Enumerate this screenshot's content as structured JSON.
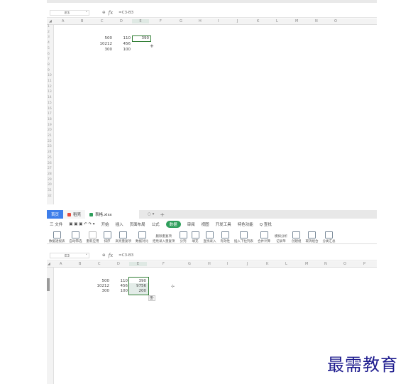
{
  "top": {
    "cell_ref": "E3",
    "formula": "=C3-B3",
    "columns": [
      "A",
      "B",
      "C",
      "D",
      "E",
      "F",
      "G",
      "H",
      "I",
      "J",
      "K",
      "L",
      "M",
      "N",
      "O"
    ],
    "rows": [
      "1",
      "2",
      "3",
      "4",
      "5",
      "6",
      "7",
      "8",
      "9",
      "10",
      "11",
      "12",
      "13",
      "14",
      "15",
      "16",
      "17",
      "18",
      "19",
      "20",
      "21",
      "22",
      "23",
      "24",
      "25",
      "26",
      "27",
      "28",
      "29",
      "30",
      "31",
      "32"
    ],
    "cells": [
      {
        "v": "500"
      },
      {
        "v": "110"
      },
      {
        "v": "390"
      },
      {
        "v": "10212"
      },
      {
        "v": "456"
      },
      {
        "v": "300"
      },
      {
        "v": "100"
      }
    ]
  },
  "bottom": {
    "tabs": {
      "home": "首页",
      "doc": "稻壳",
      "file": "表格.xlsx"
    },
    "menu": [
      "三 文件",
      "开始",
      "插入",
      "页面布局",
      "公式",
      "数据",
      "审阅",
      "视图",
      "开发工具",
      "特色功能",
      "Q 查找"
    ],
    "active_menu": "数据",
    "toolbar": [
      "数据透视表",
      "自动筛选",
      "重新应用",
      "排序",
      "高亮重复项",
      "数据对比",
      "删除重复项",
      "拒绝录入重复项",
      "分列",
      "填充",
      "查找录入",
      "有效性",
      "插入下拉列表",
      "合并计算",
      "记录单",
      "模拟分析",
      "创建组",
      "取消组合",
      "分类汇总"
    ],
    "cell_ref": "E3",
    "formula": "=C3-B3",
    "columns": [
      "A",
      "B",
      "C",
      "D",
      "E",
      "F",
      "G",
      "H",
      "I",
      "J",
      "K",
      "L",
      "M",
      "N",
      "O",
      "P"
    ],
    "cells": [
      {
        "v": "500"
      },
      {
        "v": "110"
      },
      {
        "v": "390"
      },
      {
        "v": "10212"
      },
      {
        "v": "456"
      },
      {
        "v": "9756"
      },
      {
        "v": "300"
      },
      {
        "v": "100"
      },
      {
        "v": "200"
      }
    ],
    "fill_options": "田·"
  },
  "watermark": "最需教育"
}
